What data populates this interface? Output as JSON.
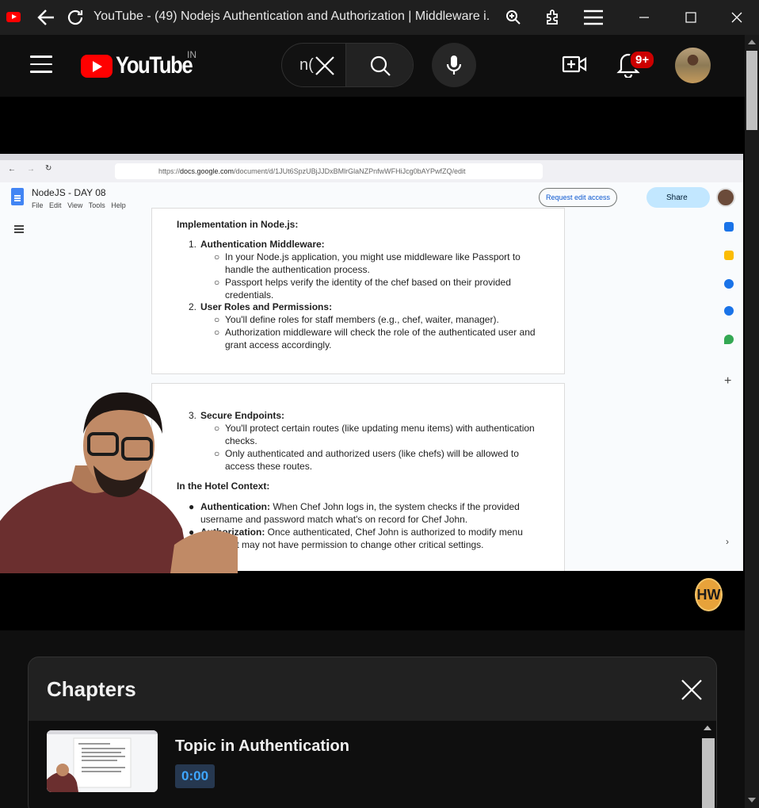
{
  "window": {
    "title": "YouTube - (49) Nodejs Authentication and Authorization | Middleware i...",
    "icons": [
      "youtube-favicon",
      "back-icon",
      "reload-icon",
      "zoom-icon",
      "extensions-icon",
      "menu-icon",
      "minimize-icon",
      "maximize-icon",
      "close-icon"
    ]
  },
  "header": {
    "logo_text": "YouTube",
    "country_code": "IN",
    "search_value": "n(",
    "notification_count": "9+"
  },
  "video": {
    "browser_url_host": "docs.google.com",
    "browser_url_prefix": "https://",
    "browser_url_path": "/document/d/1JUt6SpzUBjJJDxBMlrGlaNZPnfwWFHiJcg0bAYPwfZQ/edit",
    "doc_title": "NodeJS - DAY 08",
    "doc_menus": [
      "File",
      "Edit",
      "View",
      "Tools",
      "Help"
    ],
    "request_edit": "Request edit access",
    "share": "Share",
    "heading1": "Implementation in Node.js:",
    "item1_num": "1.",
    "item1_title": "Authentication Middleware:",
    "item1_b1": "In your Node.js application, you might use middleware like Passport to handle the authentication process.",
    "item1_b2": "Passport helps verify the identity of the chef based on their provided credentials.",
    "item2_num": "2.",
    "item2_title": "User Roles and Permissions:",
    "item2_b1": "You'll define roles for staff members (e.g., chef, waiter, manager).",
    "item2_b2": "Authorization middleware will check the role of the authenticated user and grant access accordingly.",
    "item3_num": "3.",
    "item3_title": "Secure Endpoints:",
    "item3_b1": "You'll protect certain routes (like updating menu items) with authentication checks.",
    "item3_b2": "Only authenticated and authorized users (like chefs) will be allowed to access these routes.",
    "heading2": "In the Hotel Context:",
    "ctx1_label": "Authentication:",
    "ctx1_text": "When Chef John logs in, the system checks if the provided username and password match what's on record for Chef John.",
    "ctx2_label": "Authorization:",
    "ctx2_text": "Once authenticated, Chef John is authorized to modify menu items but may not have permission to change other critical settings.",
    "watermark": "HW"
  },
  "chapters": {
    "title": "Chapters",
    "items": [
      {
        "title": "Topic in Authentication",
        "time": "0:00"
      }
    ]
  },
  "colors": {
    "brand_red": "#ff0000",
    "time_blue": "#3ea6ff",
    "share_blue": "#c2e7ff"
  }
}
